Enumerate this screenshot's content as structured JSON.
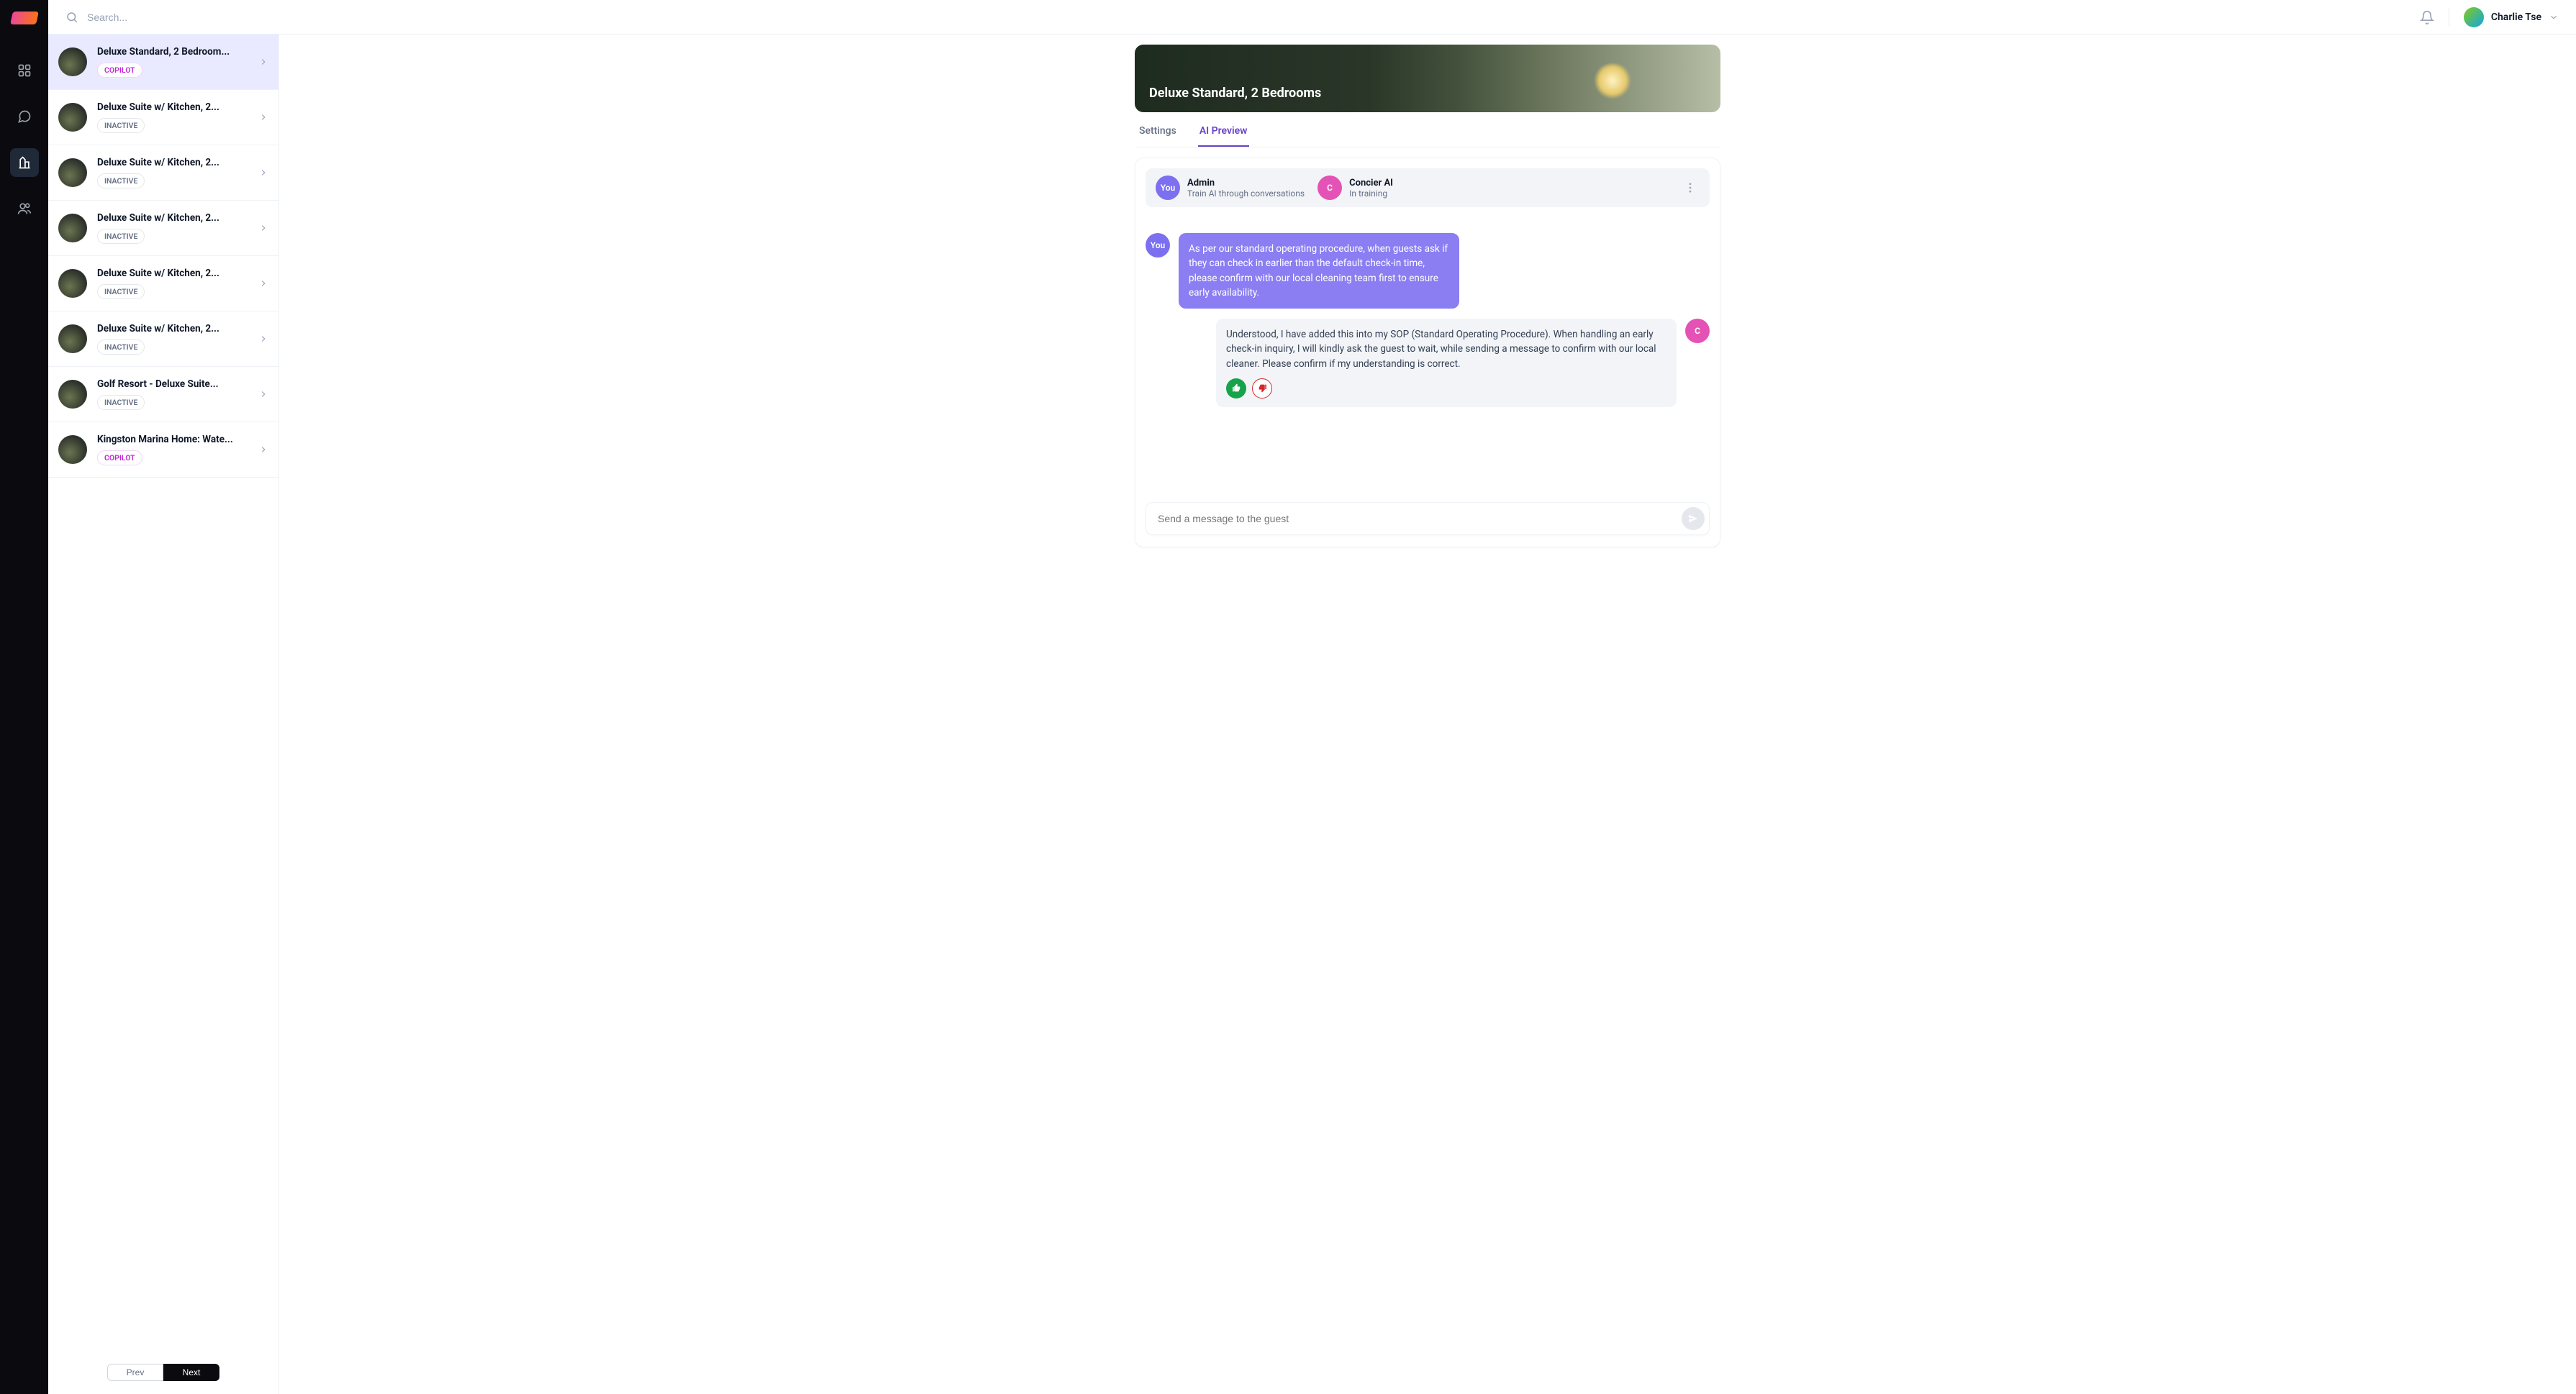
{
  "header": {
    "search_placeholder": "Search...",
    "user_name": "Charlie Tse"
  },
  "listings": [
    {
      "title": "Deluxe Standard, 2 Bedroom...",
      "status": "COPILOT",
      "status_type": "copilot",
      "selected": true
    },
    {
      "title": "Deluxe Suite w/ Kitchen, 2...",
      "status": "INACTIVE",
      "status_type": "inactive",
      "selected": false
    },
    {
      "title": "Deluxe Suite w/ Kitchen, 2...",
      "status": "INACTIVE",
      "status_type": "inactive",
      "selected": false
    },
    {
      "title": "Deluxe Suite w/ Kitchen, 2...",
      "status": "INACTIVE",
      "status_type": "inactive",
      "selected": false
    },
    {
      "title": "Deluxe Suite w/ Kitchen, 2...",
      "status": "INACTIVE",
      "status_type": "inactive",
      "selected": false
    },
    {
      "title": "Deluxe Suite w/ Kitchen, 2...",
      "status": "INACTIVE",
      "status_type": "inactive",
      "selected": false
    },
    {
      "title": "Golf Resort - Deluxe Suite...",
      "status": "INACTIVE",
      "status_type": "inactive",
      "selected": false
    },
    {
      "title": "Kingston Marina Home: Wate...",
      "status": "COPILOT",
      "status_type": "copilot",
      "selected": false
    }
  ],
  "pager": {
    "prev": "Prev",
    "next": "Next"
  },
  "hero": {
    "title": "Deluxe Standard, 2 Bedrooms"
  },
  "tabs": {
    "settings": "Settings",
    "ai_preview": "AI Preview"
  },
  "participants": {
    "you_label": "You",
    "admin": {
      "name": "Admin",
      "sub": "Train AI through conversations"
    },
    "ai": {
      "initial": "C",
      "name": "Concier AI",
      "sub": "In training"
    }
  },
  "messages": {
    "user": "As per our standard operating procedure, when guests ask if they can check in earlier than the default check-in time, please confirm with our local cleaning team first to ensure early availability.",
    "ai": "Understood, I have added this into my SOP (Standard Operating Procedure). When handling an early check-in inquiry, I will kindly ask the guest to wait, while sending a message to confirm with our local cleaner. Please confirm if my understanding is correct."
  },
  "composer": {
    "placeholder": "Send a message to the guest"
  }
}
